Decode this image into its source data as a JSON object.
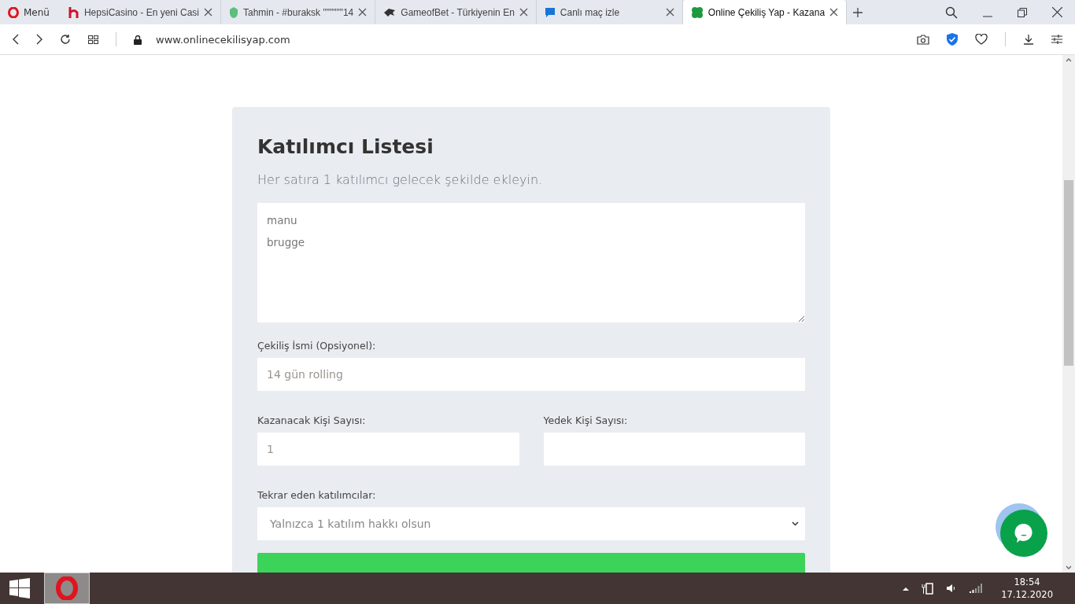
{
  "browser": {
    "menu_label": "Menü",
    "tabs": [
      {
        "title": "HepsiCasino - En yeni Casi",
        "selected": false
      },
      {
        "title": "Tahmin - #buraksk \"\"\"\"\"\"14",
        "selected": false
      },
      {
        "title": "GameofBet - Türkiyenin En",
        "selected": false
      },
      {
        "title": "Canlı maç izle",
        "selected": false
      },
      {
        "title": "Online Çekiliş Yap - Kazana",
        "selected": true
      }
    ],
    "address": "www.onlinecekilisyap.com"
  },
  "form": {
    "title": "Katılımcı Listesi",
    "subtitle": "Her satıra 1 katılımcı gelecek şekilde ekleyin.",
    "participants": "manu\nbrugge",
    "draw_name_label": "Çekiliş İsmi (Opsiyonel):",
    "draw_name": "14 gün rolling",
    "winners_label": "Kazanacak Kişi Sayısı:",
    "winners": "1",
    "backup_label": "Yedek Kişi Sayısı:",
    "repeat_label": "Tekrar eden katılımcılar:",
    "repeat_option": "Yalnızca 1 katılım hakkı olsun"
  },
  "taskbar": {
    "time": "18:54",
    "date": "17.12.2020"
  }
}
